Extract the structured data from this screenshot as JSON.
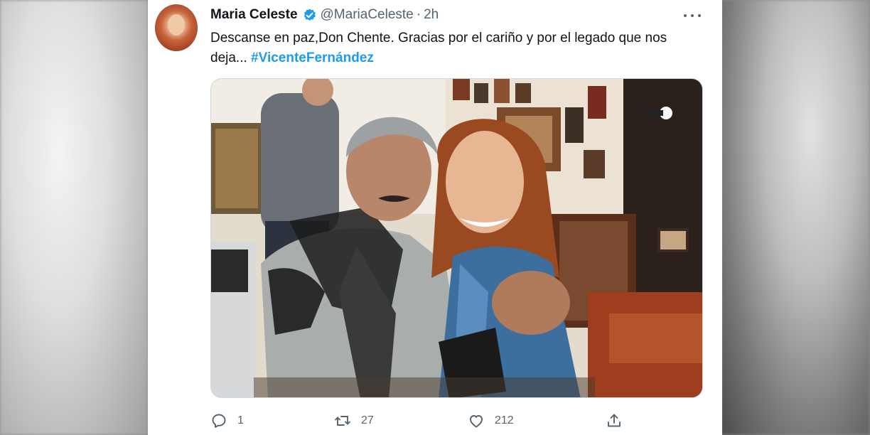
{
  "tweet": {
    "author_name": "Maria Celeste",
    "handle": "@MariaCeleste",
    "separator": "·",
    "time": "2h",
    "verified": true,
    "text_main": "Descanse en paz,Don Chente. Gracias por el cariño y por el legado que nos deja...",
    "hashtag": "#VicenteFernández",
    "media": {
      "type": "photo"
    },
    "actions": {
      "reply": {
        "icon": "reply-icon",
        "count": "1"
      },
      "retweet": {
        "icon": "retweet-icon",
        "count": "27"
      },
      "like": {
        "icon": "heart-icon",
        "count": "212"
      },
      "share": {
        "icon": "share-icon"
      }
    }
  },
  "colors": {
    "accent": "#1d9bf0",
    "text": "#0f1419",
    "muted": "#536471"
  }
}
